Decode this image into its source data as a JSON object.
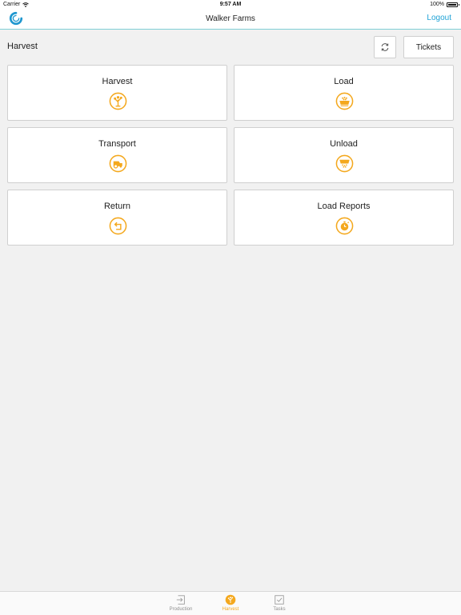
{
  "status_bar": {
    "carrier": "Carrier",
    "time": "9:57 AM",
    "battery": "100%",
    "battery_level": 1.0
  },
  "nav": {
    "title": "Walker Farms",
    "logout_label": "Logout",
    "logo_icon": "app-logo-icon"
  },
  "header": {
    "title": "Harvest",
    "refresh_icon": "refresh-icon",
    "tickets_label": "Tickets"
  },
  "tiles": [
    {
      "label": "Harvest",
      "icon": "tree-icon"
    },
    {
      "label": "Load",
      "icon": "load-bin-icon"
    },
    {
      "label": "Transport",
      "icon": "truck-icon"
    },
    {
      "label": "Unload",
      "icon": "unload-bin-icon"
    },
    {
      "label": "Return",
      "icon": "return-arrow-icon"
    },
    {
      "label": "Load Reports",
      "icon": "stopwatch-icon"
    }
  ],
  "tabs": [
    {
      "label": "Production",
      "icon": "production-icon",
      "active": false
    },
    {
      "label": "Harvest",
      "icon": "harvest-icon",
      "active": true
    },
    {
      "label": "Tasks",
      "icon": "tasks-icon",
      "active": false
    }
  ],
  "colors": {
    "accent": "#f4a81d",
    "link": "#1fa2d6",
    "background": "#f1f1f1",
    "divider": "#7fd0d6"
  }
}
